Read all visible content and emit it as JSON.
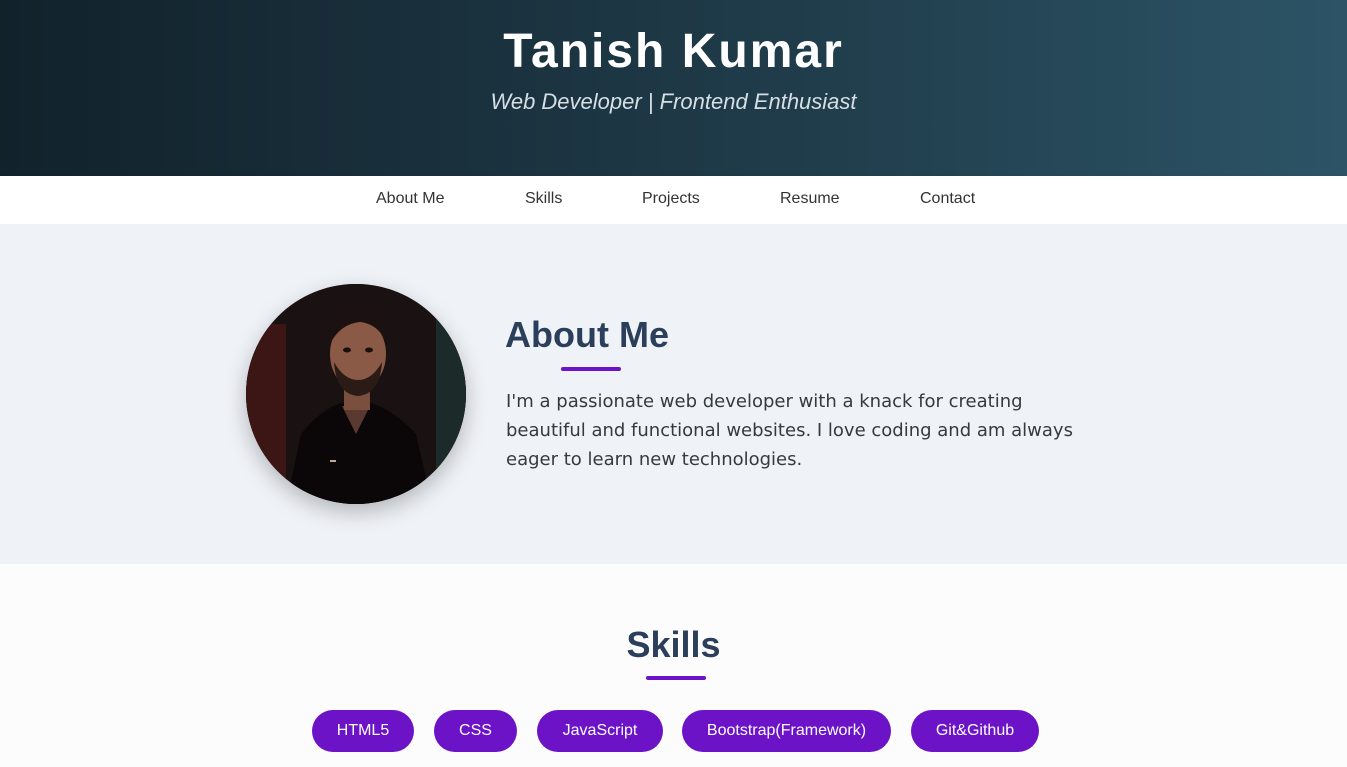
{
  "header": {
    "name": "Tanish Kumar",
    "tagline": "Web Developer | Frontend Enthusiast"
  },
  "nav": {
    "items": [
      "About Me",
      "Skills",
      "Projects",
      "Resume",
      "Contact"
    ]
  },
  "about": {
    "title": "About Me",
    "text": "I'm a passionate web developer with a knack for creating beautiful and functional websites. I love coding and am always eager to learn new technologies.",
    "photo": "profile-photo"
  },
  "skills": {
    "title": "Skills",
    "items": [
      "HTML5",
      "CSS",
      "JavaScript",
      "Bootstrap(Framework)",
      "Git&Github"
    ]
  },
  "colors": {
    "accent": "#6c12c7",
    "heading": "#2b3f5a",
    "header_gradient_start": "#11222b",
    "header_gradient_end": "#2c5466"
  }
}
